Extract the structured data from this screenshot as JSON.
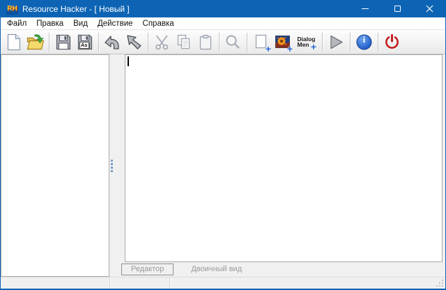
{
  "window": {
    "title": "Resource Hacker - [ Новый ]",
    "icon_text": "RH",
    "accent_color": "#0d64b4"
  },
  "menu": {
    "items": [
      {
        "label": "Файл"
      },
      {
        "label": "Правка"
      },
      {
        "label": "Вид"
      },
      {
        "label": "Действие"
      },
      {
        "label": "Справка"
      }
    ]
  },
  "toolbar": {
    "icons": [
      "new-file-icon",
      "open-folder-icon",
      "save-icon",
      "save-as-icon",
      "arrow-back-icon",
      "arrow-forward-icon",
      "cut-icon",
      "copy-icon",
      "paste-icon",
      "find-icon",
      "add-resource-icon",
      "add-image-resource-icon",
      "add-dialog-menu-icon",
      "run-icon",
      "info-icon",
      "exit-icon"
    ],
    "save_as_label": "As",
    "dialog_menu_icon": {
      "line1": "Dialog",
      "line2": "Men"
    },
    "plus_glyph": "+",
    "info_glyph": "i"
  },
  "editor": {
    "text": ""
  },
  "tabs": [
    {
      "label": "Редактор",
      "active": true
    },
    {
      "label": "Двоичный вид",
      "active": false
    }
  ],
  "statusbar": {
    "sections": [
      "",
      "",
      ""
    ]
  },
  "colors": {
    "titlebar_blue": "#0d64b4",
    "plus_blue": "#2563cf",
    "info_blue": "#1b56c4",
    "power_red": "#c41f1f",
    "folder_yellow": "#f2d469",
    "disabled_gray": "#b8bcc0"
  }
}
